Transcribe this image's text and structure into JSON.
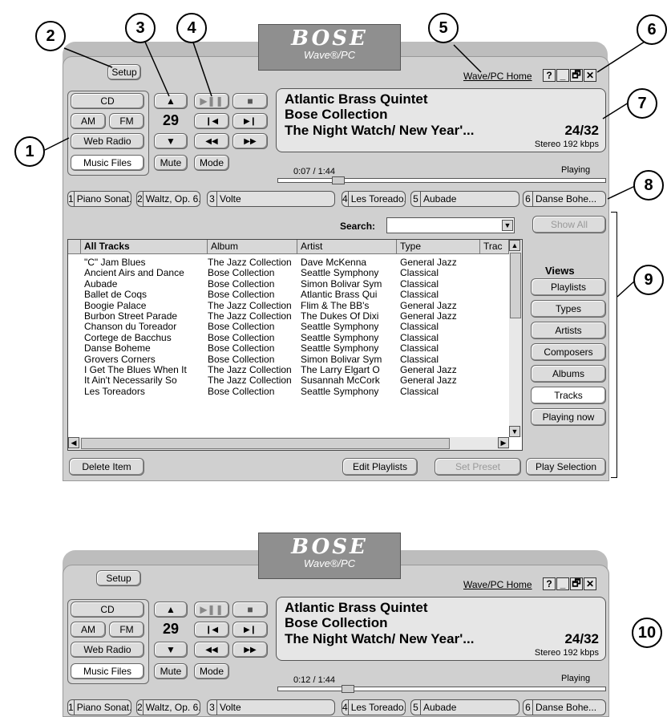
{
  "callouts": [
    "1",
    "2",
    "3",
    "4",
    "5",
    "6",
    "7",
    "8",
    "9",
    "10"
  ],
  "logo": {
    "brand": "BOSE",
    "product": "Wave®/PC"
  },
  "home_link": "Wave/PC Home",
  "window_buttons": [
    "?",
    "_",
    "🗗",
    "✕"
  ],
  "setup": "Setup",
  "source_buttons": {
    "cd": "CD",
    "am": "AM",
    "fm": "FM",
    "web_radio": "Web Radio",
    "music_files": "Music Files"
  },
  "volume": {
    "value": "29",
    "mute": "Mute"
  },
  "transport": {
    "play_pause": "▶❚❚",
    "stop": "■",
    "prev": "❙◀",
    "next": "▶❙",
    "rewind": "◀◀",
    "forward": "▶▶",
    "mode": "Mode"
  },
  "display_top": {
    "line1": "Atlantic Brass Quintet",
    "line2": "Bose Collection",
    "line3": "The Night Watch/ New Year'...",
    "count": "24/32",
    "quality": "Stereo 192 kbps",
    "time": "0:07 / 1:44",
    "status": "Playing",
    "progress": 0.17
  },
  "display_bottom": {
    "line1": "Atlantic Brass Quintet",
    "line2": "Bose Collection",
    "line3": "The Night Watch/ New Year'...",
    "count": "24/32",
    "quality": "Stereo 192 kbps",
    "time": "0:12 / 1:44",
    "status": "Playing",
    "progress": 0.2
  },
  "presets": [
    {
      "n": "1",
      "label": "Piano Sonat..."
    },
    {
      "n": "2",
      "label": "Waltz, Op. 6..."
    },
    {
      "n": "3",
      "label": "Volte"
    },
    {
      "n": "4",
      "label": "Les Toreado..."
    },
    {
      "n": "5",
      "label": "Aubade"
    },
    {
      "n": "6",
      "label": "Danse Bohe..."
    }
  ],
  "search_label": "Search:",
  "show_all": "Show All",
  "views": {
    "title": "Views",
    "items": [
      "Playlists",
      "Types",
      "Artists",
      "Composers",
      "Albums",
      "Tracks",
      "Playing now"
    ],
    "selected": 5
  },
  "table": {
    "headers": [
      "All Tracks",
      "Album",
      "Artist",
      "Type",
      "Trac"
    ],
    "rows": [
      [
        "\"C\" Jam Blues",
        "The Jazz Collection",
        "Dave McKenna",
        "General Jazz"
      ],
      [
        "Ancient Airs and Dance",
        "Bose Collection",
        "Seattle Symphony",
        "Classical"
      ],
      [
        "Aubade",
        "Bose Collection",
        "Simon Bolivar Sym",
        "Classical"
      ],
      [
        "Ballet de Coqs",
        "Bose Collection",
        "Atlantic Brass Qui",
        "Classical"
      ],
      [
        "Boogie Palace",
        "The Jazz Collection",
        "Flim & The BB's",
        "General Jazz"
      ],
      [
        "Burbon Street Parade",
        "The Jazz Collection",
        "The Dukes Of Dixi",
        "General Jazz"
      ],
      [
        "Chanson du Toreador",
        "Bose Collection",
        "Seattle Symphony",
        "Classical"
      ],
      [
        "Cortege de Bacchus",
        "Bose Collection",
        "Seattle Symphony",
        "Classical"
      ],
      [
        "Danse Boheme",
        "Bose Collection",
        "Seattle Symphony",
        "Classical"
      ],
      [
        "Grovers Corners",
        "Bose Collection",
        "Simon Bolivar Sym",
        "Classical"
      ],
      [
        "I Get The Blues When It",
        "The Jazz Collection",
        "The Larry Elgart O",
        "General Jazz"
      ],
      [
        "It Ain't Necessarily So",
        "The Jazz Collection",
        "Susannah McCork",
        "General Jazz"
      ],
      [
        "Les Toreadors",
        "Bose Collection",
        "Seattle Symphony",
        "Classical"
      ]
    ]
  },
  "bottom_buttons": {
    "delete": "Delete Item",
    "edit": "Edit Playlists",
    "set_preset": "Set Preset",
    "play": "Play Selection"
  }
}
